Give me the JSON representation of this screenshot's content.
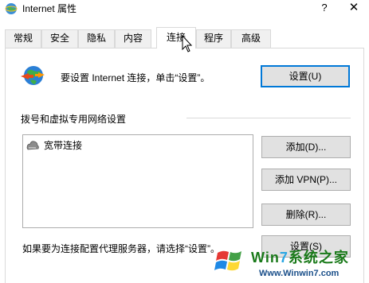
{
  "window": {
    "title": "Internet 属性",
    "help_label": "?",
    "close_label": "✕"
  },
  "tabs": [
    {
      "label": "常规"
    },
    {
      "label": "安全"
    },
    {
      "label": "隐私"
    },
    {
      "label": "内容"
    },
    {
      "label": "连接",
      "active": true
    },
    {
      "label": "程序"
    },
    {
      "label": "高级"
    }
  ],
  "setup": {
    "text": "要设置 Internet 连接，单击“设置”。",
    "button_label": "设置(U)"
  },
  "dialup": {
    "section_title": "拨号和虚拟专用网络设置",
    "connections": [
      {
        "label": "宽带连接"
      }
    ],
    "add_button": "添加(D)...",
    "add_vpn_button": "添加 VPN(P)...",
    "remove_button": "删除(R)..."
  },
  "proxy": {
    "text": "如果要为连接配置代理服务器，请选择“设置”。",
    "button_label": "设置(S)"
  },
  "watermark": {
    "title_prefix": "Win",
    "title_num": "7",
    "title_suffix": "系统之家",
    "url": "Www.Winwin7.com"
  },
  "colors": {
    "accent": "#0078d7",
    "button_bg": "#e1e1e1",
    "border": "#adadad"
  }
}
